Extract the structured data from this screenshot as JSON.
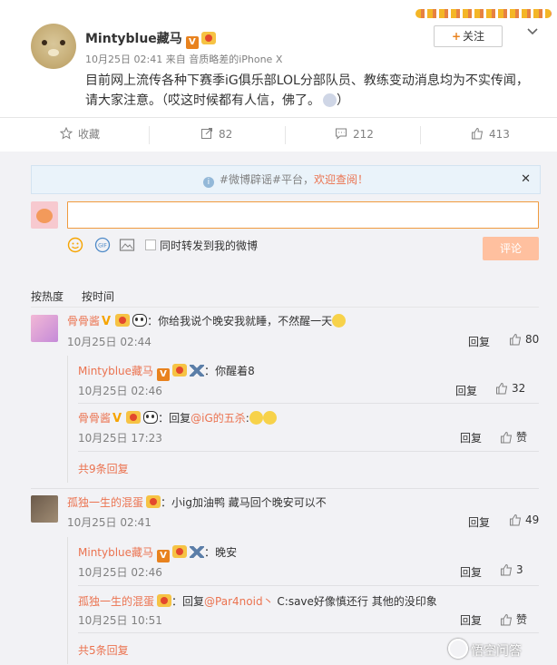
{
  "post": {
    "author": "Mintyblue藏马",
    "time": "10月25日 02:41",
    "source": "来自 音质略差的iPhone X",
    "follow_label": "关注",
    "text": "目前网上流传各种下赛季iG俱乐部LOL分部队员、教练变动消息均为不实传闻，请大家注意。（哎这时候都有人信，佛了。"
  },
  "actions": {
    "favorite": "收藏",
    "repost": "82",
    "comment": "212",
    "like": "413"
  },
  "notice": {
    "text_prefix": "#微博辟谣#平台，",
    "link": "欢迎查阅！"
  },
  "composer": {
    "repost_label": "同时转发到我的微博",
    "submit_label": "评论"
  },
  "sort": {
    "hot": "按热度",
    "time": "按时间"
  },
  "comments": [
    {
      "user": "骨骨酱",
      "text": "你给我说个晚安我就睡，不然醒一天",
      "time": "10月25日 02:44",
      "reply": "回复",
      "likes": "80",
      "replies": [
        {
          "user": "Mintyblue藏马",
          "text": "你醒着8",
          "time": "10月25日 02:46",
          "reply": "回复",
          "likes": "32"
        },
        {
          "user": "骨骨酱",
          "text_prefix": "回复",
          "mention": "@iG的五杀",
          "text": ":",
          "time": "10月25日 17:23",
          "reply": "回复",
          "likes": "赞"
        }
      ],
      "more": "共9条回复"
    },
    {
      "user": "孤独一生的混蛋",
      "text": "小ig加油鸭 藏马回个晚安可以不",
      "time": "10月25日 02:41",
      "reply": "回复",
      "likes": "49",
      "replies": [
        {
          "user": "Mintyblue藏马",
          "text": "晚安",
          "time": "10月25日 02:46",
          "reply": "回复",
          "likes": "3"
        },
        {
          "user": "孤独一生的混蛋",
          "text_prefix": "回复",
          "mention": "@Par4noid丶",
          "text": " C:save好像慎还行 其他的没印象",
          "time": "10月25日 10:51",
          "reply": "回复",
          "likes": "赞"
        }
      ],
      "more": "共5条回复"
    }
  ],
  "watermark": "悟空问答",
  "colors": {
    "accent": "#eb7350",
    "vip": "#e8821e"
  }
}
